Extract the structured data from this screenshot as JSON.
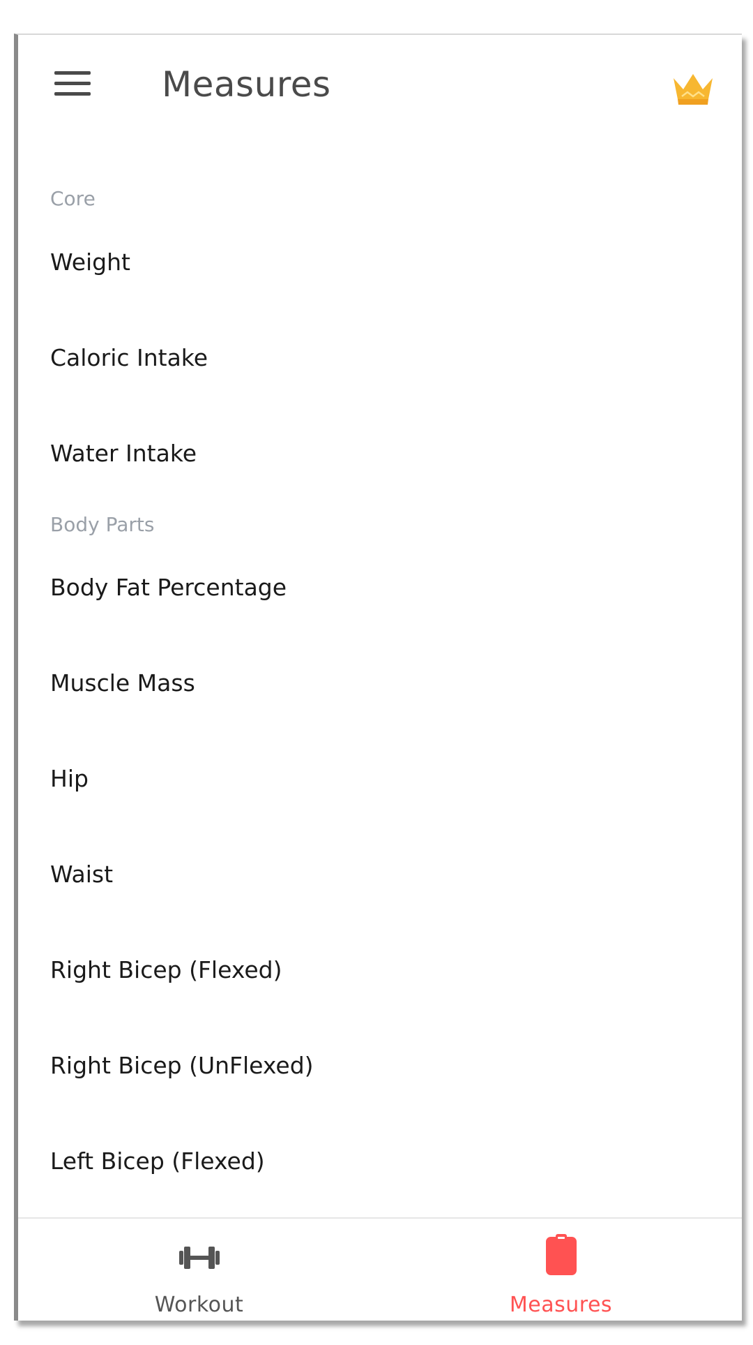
{
  "appbar": {
    "title": "Measures",
    "menu_icon": "menu-icon",
    "premium_icon": "crown-icon"
  },
  "sections": [
    {
      "header": "Core",
      "items": [
        "Weight",
        "Caloric Intake",
        "Water Intake"
      ]
    },
    {
      "header": "Body Parts",
      "items": [
        "Body Fat Percentage",
        "Muscle Mass",
        "Hip",
        "Waist",
        "Right Bicep (Flexed)",
        "Right Bicep (UnFlexed)",
        "Left Bicep (Flexed)"
      ]
    }
  ],
  "bottom_nav": {
    "tabs": [
      {
        "label": "Workout",
        "icon": "dumbbell-icon",
        "active": false
      },
      {
        "label": "Measures",
        "icon": "clipboard-icon",
        "active": true
      }
    ]
  },
  "colors": {
    "accent": "#ff5252",
    "crown": "#f7b731",
    "inactive": "#555555",
    "section_header": "#9aa0a8"
  }
}
